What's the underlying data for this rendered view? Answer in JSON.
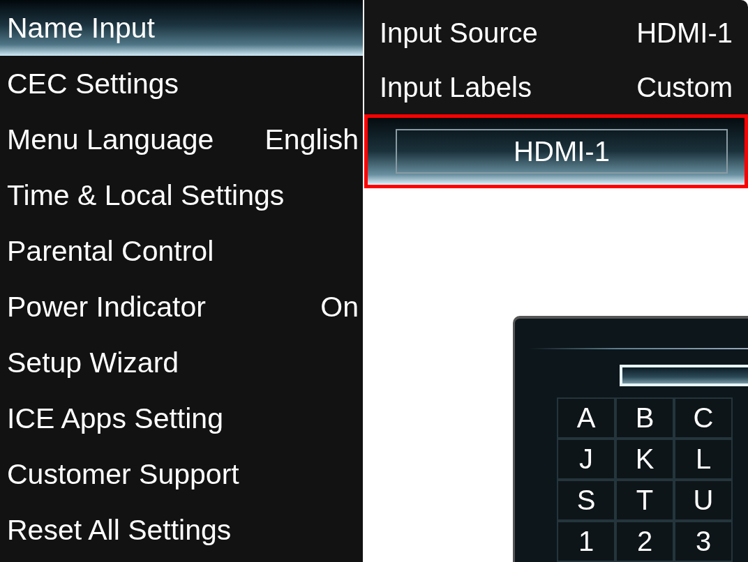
{
  "settings_menu": {
    "items": [
      {
        "label": "Name Input",
        "selected": true
      },
      {
        "label": "CEC Settings",
        "selected": false
      },
      {
        "label": "Menu Language",
        "value": "English",
        "selected": false
      },
      {
        "label": "Time & Local Settings",
        "selected": false
      },
      {
        "label": "Parental Control",
        "selected": false
      },
      {
        "label": "Power Indicator",
        "value": "On",
        "selected": false
      },
      {
        "label": "Setup Wizard",
        "selected": false
      },
      {
        "label": "ICE Apps Setting",
        "selected": false
      },
      {
        "label": "Customer Support",
        "selected": false
      },
      {
        "label": "Reset All Settings",
        "selected": false
      }
    ]
  },
  "input_panel": {
    "rows": [
      {
        "label": "Input Source",
        "value": "HDMI-1"
      },
      {
        "label": "Input Labels",
        "value": "Custom"
      }
    ],
    "name_field": {
      "value": "HDMI-1",
      "highlighted": true
    }
  },
  "keyboard": {
    "keys": [
      [
        "A",
        "B",
        "C"
      ],
      [
        "J",
        "K",
        "L"
      ],
      [
        "S",
        "T",
        "U"
      ],
      [
        "1",
        "2",
        "3"
      ]
    ]
  }
}
